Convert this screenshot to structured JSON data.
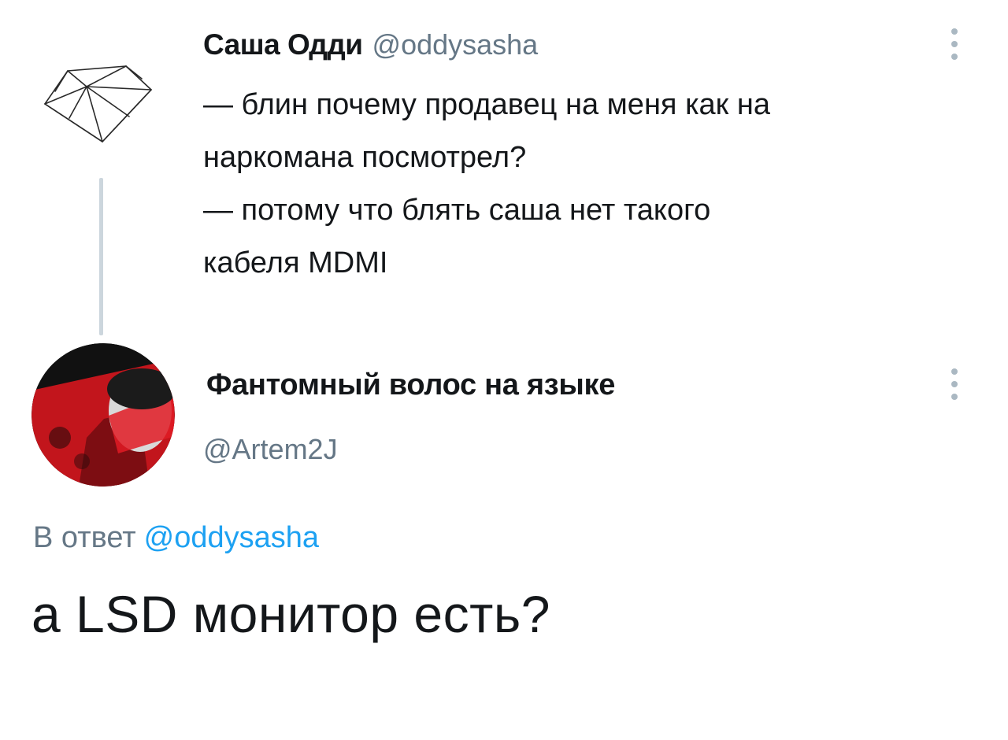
{
  "parent_tweet": {
    "avatar_icon": "diamond-icon",
    "author_name": "Саша Одди",
    "author_handle": "@oddysasha",
    "lines": [
      "— блин почему продавец на меня как на",
      "наркомана посмотрел?",
      "— потому что блять саша нет такого",
      "кабеля MDMI"
    ],
    "menu_icon": "more-vertical-icon"
  },
  "reply_tweet": {
    "avatar_icon": "user-avatar",
    "author_name": "Фантомный волос на языке",
    "author_handle": "@Artem2J",
    "menu_icon": "more-vertical-icon",
    "reply_to_label": "В ответ",
    "reply_to_handle": "@oddysasha",
    "text": "а LSD монитор есть?"
  },
  "colors": {
    "text_primary": "#14171a",
    "text_secondary": "#657786",
    "link": "#1da1f2",
    "thread_line": "#ccd6dd",
    "menu_dots": "#aab8c2",
    "avatar_red": "#e01b24"
  }
}
